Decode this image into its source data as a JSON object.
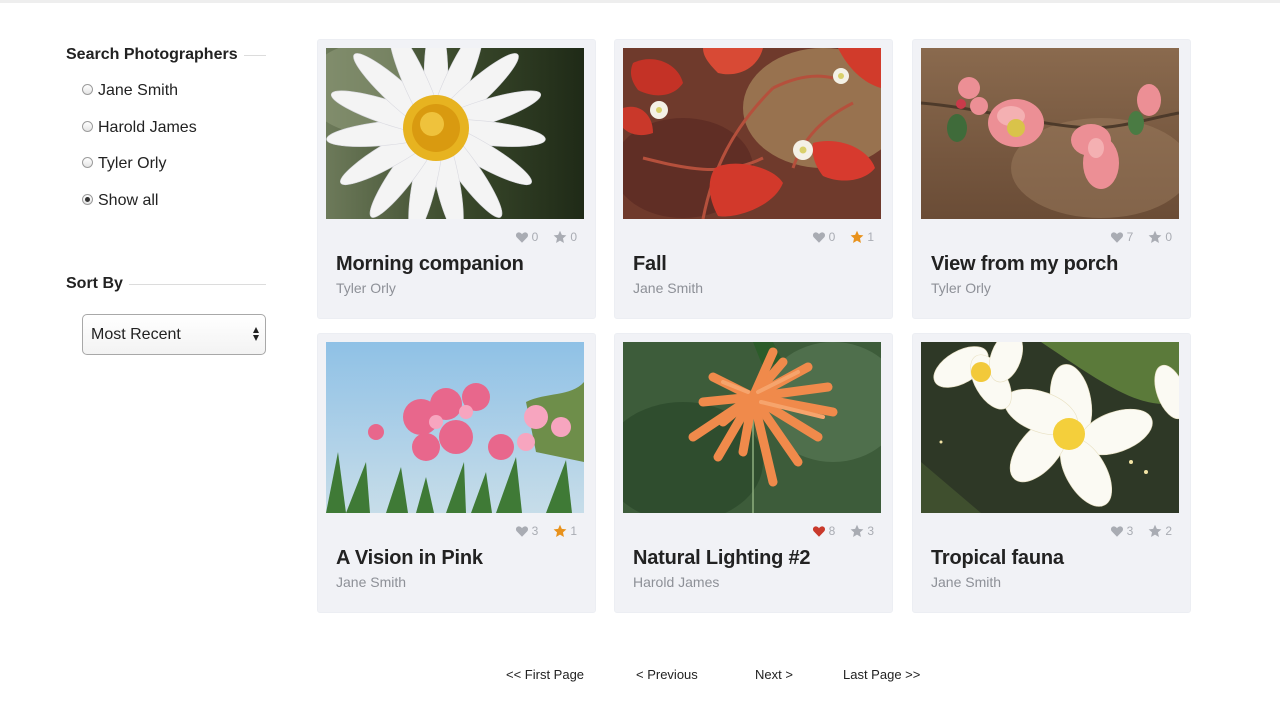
{
  "sidebar": {
    "photographers_title": "Search Photographers",
    "photographers": [
      {
        "label": "Jane Smith",
        "checked": false
      },
      {
        "label": "Harold James",
        "checked": false
      },
      {
        "label": "Tyler Orly",
        "checked": false
      },
      {
        "label": "Show all",
        "checked": true
      }
    ],
    "sort_title": "Sort By",
    "sort_selected": "Most Recent"
  },
  "colors": {
    "card_bg": "#f1f2f6",
    "stat_gray": "#a9acb3",
    "liked_red": "#c9392b",
    "star_orange": "#e8921c"
  },
  "photos": [
    {
      "title": "Morning companion",
      "author": "Tyler Orly",
      "likes": "0",
      "stars": "0",
      "liked": false,
      "starred": false,
      "image": "white-daisy"
    },
    {
      "title": "Fall",
      "author": "Jane Smith",
      "likes": "0",
      "stars": "1",
      "liked": false,
      "starred": true,
      "image": "red-leaves-white-blossoms"
    },
    {
      "title": "View from my porch",
      "author": "Tyler Orly",
      "likes": "7",
      "stars": "0",
      "liked": false,
      "starred": false,
      "image": "pink-quince-blossoms"
    },
    {
      "title": "A Vision in Pink",
      "author": "Jane Smith",
      "likes": "3",
      "stars": "1",
      "liked": false,
      "starred": true,
      "image": "pink-oleander-sky"
    },
    {
      "title": "Natural Lighting #2",
      "author": "Harold James",
      "likes": "8",
      "stars": "3",
      "liked": true,
      "starred": false,
      "image": "orange-trumpet-flowers"
    },
    {
      "title": "Tropical fauna",
      "author": "Jane Smith",
      "likes": "3",
      "stars": "2",
      "liked": false,
      "starred": false,
      "image": "white-frangipani"
    }
  ],
  "pagination": {
    "first": "<< First Page",
    "previous": "< Previous",
    "next": "Next >",
    "last": "Last Page >>"
  }
}
